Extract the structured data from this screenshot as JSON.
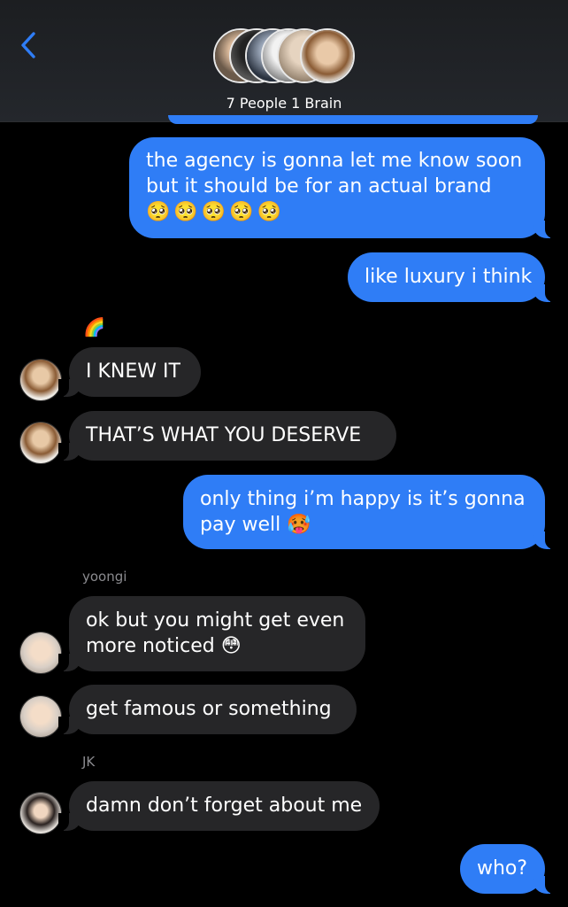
{
  "header": {
    "title": "7 People 1 Brain",
    "back_icon": "chevron-left-icon",
    "accent": "#2f7df6"
  },
  "messages": [
    {
      "id": "m1",
      "direction": "outgoing",
      "lines": [
        "the agency is gonna let me know soon",
        "but it should be for an actual brand",
        "🥺🥺🥺🥺🥺"
      ]
    },
    {
      "id": "m2",
      "direction": "outgoing",
      "lines": [
        "like luxury i think"
      ]
    },
    {
      "id": "r1",
      "reaction": "🌈"
    },
    {
      "id": "m3",
      "direction": "incoming",
      "lines": [
        "I KNEW IT"
      ]
    },
    {
      "id": "m4",
      "direction": "incoming",
      "lines": [
        "THAT’S WHAT YOU DESERVE"
      ]
    },
    {
      "id": "m5",
      "direction": "outgoing",
      "lines": [
        "only thing i’m happy is it’s gonna",
        "pay well 🥵"
      ]
    },
    {
      "id": "s1",
      "sender": "yoongi"
    },
    {
      "id": "m6",
      "direction": "incoming",
      "lines": [
        "ok but you might get even",
        "more noticed 😳"
      ]
    },
    {
      "id": "m7",
      "direction": "incoming",
      "lines": [
        "get famous or something"
      ]
    },
    {
      "id": "s2",
      "sender": "JK"
    },
    {
      "id": "m8",
      "direction": "incoming",
      "lines": [
        "damn don’t forget about me"
      ]
    },
    {
      "id": "m9",
      "direction": "outgoing",
      "lines": [
        "who?"
      ]
    }
  ],
  "colors": {
    "outgoing_bubble": "#2f7df6",
    "incoming_bubble": "#262628",
    "background": "#000000"
  }
}
